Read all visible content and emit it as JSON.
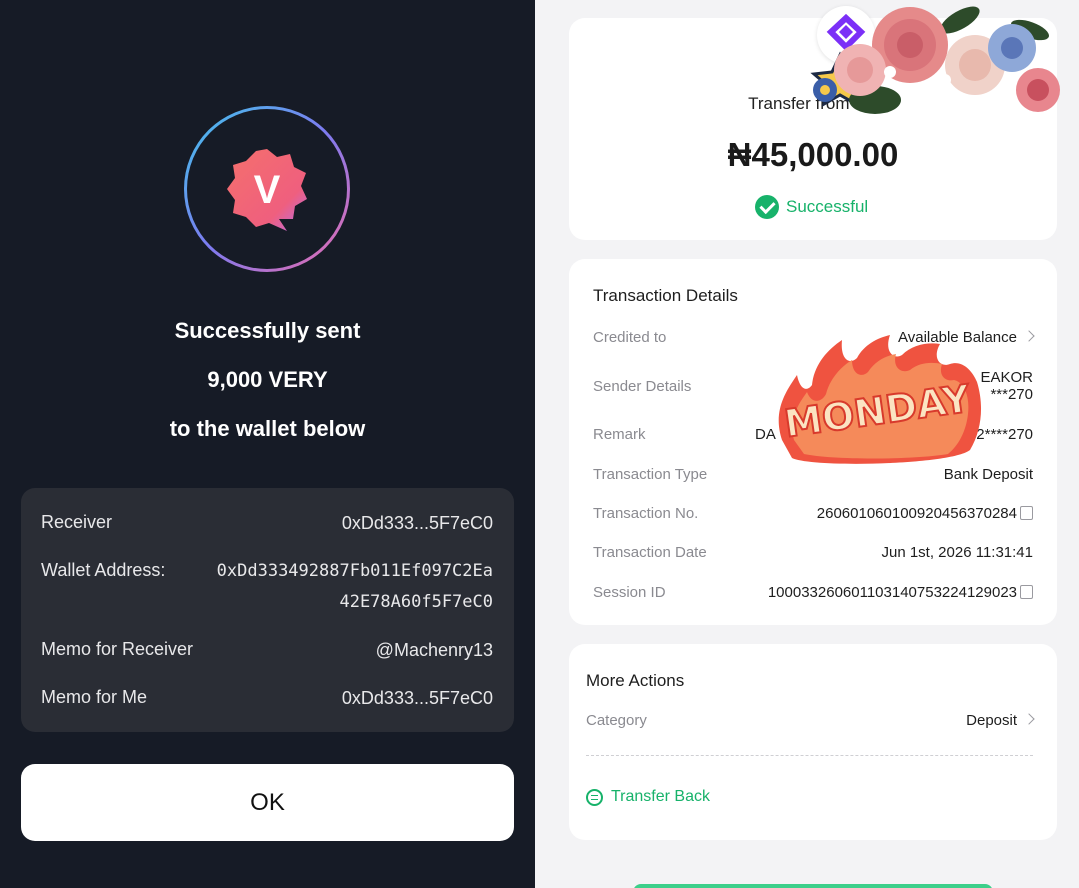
{
  "left": {
    "logo_letter": "V",
    "message_line1": "Successfully sent",
    "message_line2": "9,000 VERY",
    "message_line3": "to the wallet below",
    "details": {
      "receiver_label": "Receiver",
      "receiver_value": "0xDd333...5F7eC0",
      "wallet_label": "Wallet Address:",
      "wallet_value_line1": "0xDd333492887Fb011Ef097C2Ea",
      "wallet_value_line2": "42E78A60f5F7eC0",
      "memo_receiver_label": "Memo for Receiver",
      "memo_receiver_value": "@Machenry13",
      "memo_me_label": "Memo for Me",
      "memo_me_value": "0xDd333...5F7eC0"
    },
    "ok_label": "OK"
  },
  "right": {
    "summary": {
      "transfer_from": "Transfer from DA",
      "amount": "₦45,000.00",
      "status": "Successful"
    },
    "details": {
      "title": "Transaction Details",
      "credited_to_label": "Credited to",
      "credited_to_value": "Available Balance",
      "sender_label": "Sender Details",
      "sender_value_line1": "EAKOR",
      "sender_value_line2": "***270",
      "remark_label": "Remark",
      "remark_value_prefix": "DA",
      "remark_value_suffix": "2****270",
      "type_label": "Transaction Type",
      "type_value": "Bank Deposit",
      "no_label": "Transaction No.",
      "no_value": "260601060100920456370284",
      "date_label": "Transaction Date",
      "date_value": "Jun 1st, 2026 11:31:41",
      "session_label": "Session ID",
      "session_value": "100033260601103140753224129023"
    },
    "more_actions": {
      "title": "More Actions",
      "category_label": "Category",
      "category_value": "Deposit",
      "transfer_back_label": "Transfer Back"
    },
    "sticker_text": "MONDAY"
  },
  "colors": {
    "left_bg": "#161b26",
    "success_green": "#17b26a",
    "logo_coral": "#f26a6a",
    "brand_purple": "#7b2ff7"
  }
}
